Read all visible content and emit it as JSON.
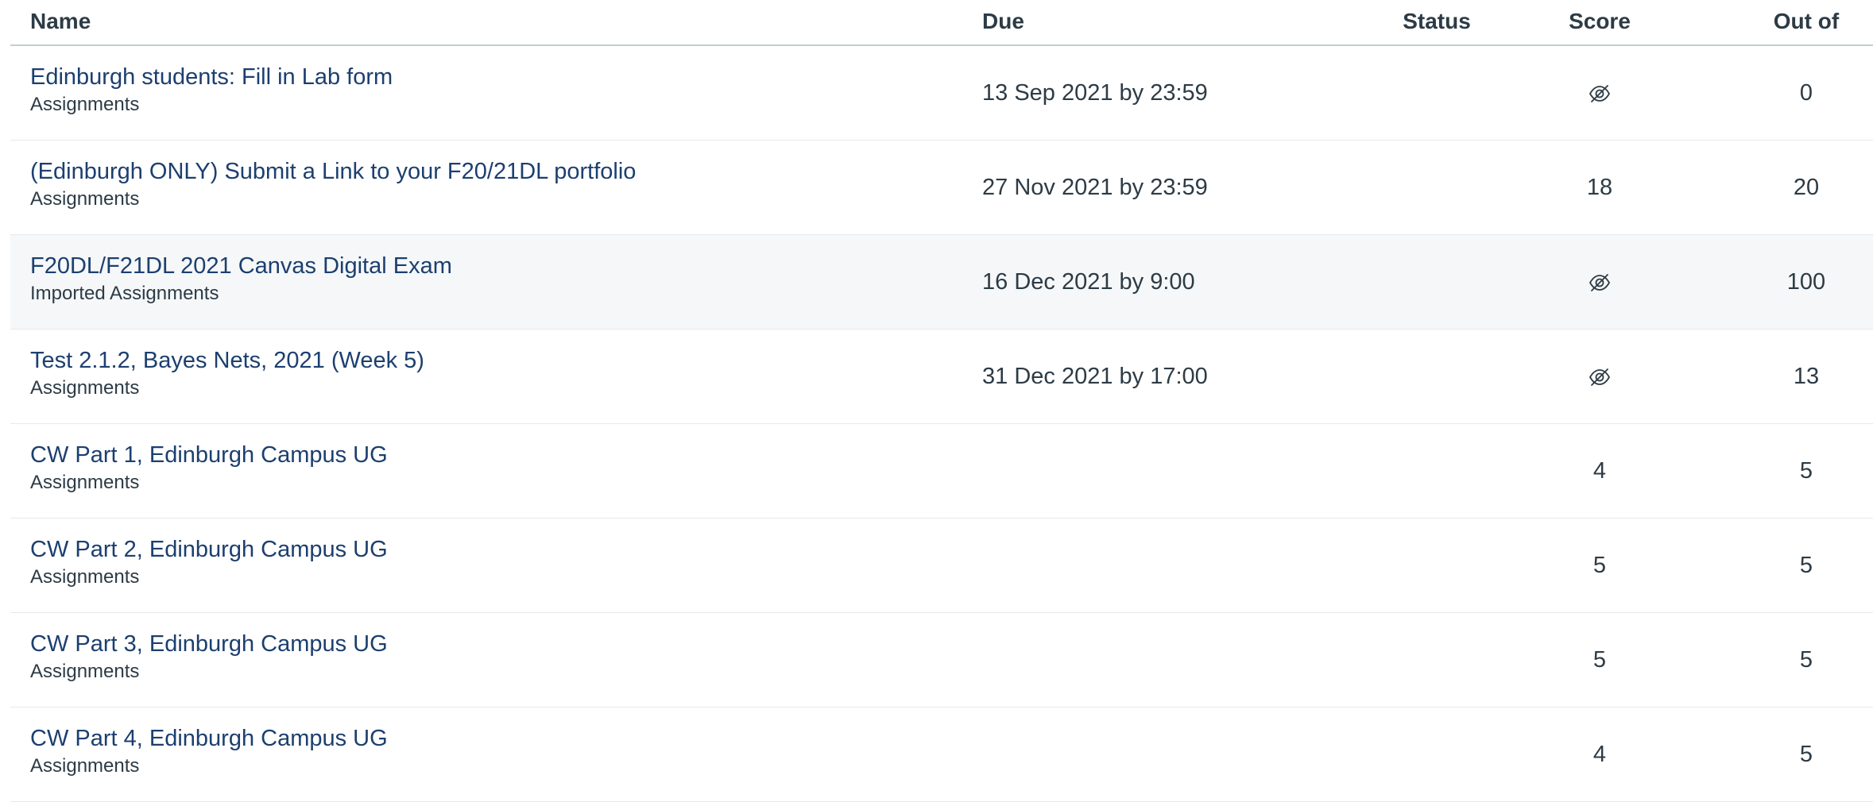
{
  "columns": {
    "name": "Name",
    "due": "Due",
    "status": "Status",
    "score": "Score",
    "out_of": "Out of"
  },
  "rows": [
    {
      "title": "Edinburgh students: Fill in Lab form",
      "category": "Assignments",
      "due": "13 Sep 2021 by 23:59",
      "status": "",
      "score": "",
      "score_icon": "eye-hidden-icon",
      "out_of": "0",
      "highlight": false
    },
    {
      "title": "(Edinburgh ONLY) Submit a Link to your F20/21DL portfolio",
      "category": "Assignments",
      "due": "27 Nov 2021 by 23:59",
      "status": "",
      "score": "18",
      "score_icon": null,
      "out_of": "20",
      "highlight": false
    },
    {
      "title": "F20DL/F21DL 2021 Canvas Digital Exam",
      "category": "Imported Assignments",
      "due": "16 Dec 2021 by 9:00",
      "status": "",
      "score": "",
      "score_icon": "eye-hidden-icon",
      "out_of": "100",
      "highlight": true
    },
    {
      "title": "Test 2.1.2, Bayes Nets, 2021 (Week 5)",
      "category": "Assignments",
      "due": "31 Dec 2021 by 17:00",
      "status": "",
      "score": "",
      "score_icon": "eye-hidden-icon",
      "out_of": "13",
      "highlight": false
    },
    {
      "title": "CW Part 1, Edinburgh Campus UG",
      "category": "Assignments",
      "due": "",
      "status": "",
      "score": "4",
      "score_icon": null,
      "out_of": "5",
      "highlight": false
    },
    {
      "title": "CW Part 2, Edinburgh Campus UG",
      "category": "Assignments",
      "due": "",
      "status": "",
      "score": "5",
      "score_icon": null,
      "out_of": "5",
      "highlight": false
    },
    {
      "title": "CW Part 3, Edinburgh Campus UG",
      "category": "Assignments",
      "due": "",
      "status": "",
      "score": "5",
      "score_icon": null,
      "out_of": "5",
      "highlight": false
    },
    {
      "title": "CW Part 4, Edinburgh Campus UG",
      "category": "Assignments",
      "due": "",
      "status": "",
      "score": "4",
      "score_icon": null,
      "out_of": "5",
      "highlight": false
    }
  ],
  "colors": {
    "link": "#1c3f6f",
    "text": "#2d3b45",
    "row_highlight": "#f5f7f9",
    "divider": "#e6e9eb",
    "header_divider": "#c7cdd1"
  }
}
